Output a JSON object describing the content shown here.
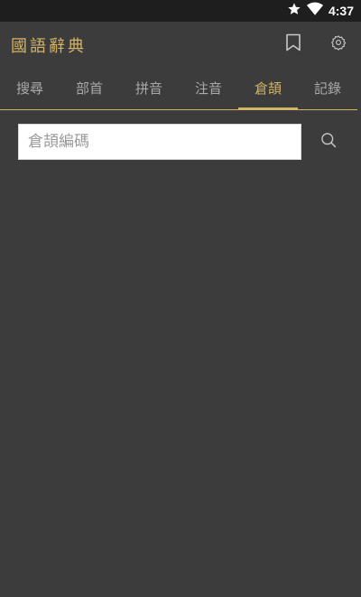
{
  "theme": {
    "accent": "#d4b465",
    "tab_text": "#a9a9a9",
    "icon_color": "#c8c8c8",
    "background": "#3c3c3c",
    "status_bar": "#1e1e1e"
  },
  "status_bar": {
    "time": "4:37",
    "icons": [
      "star-icon",
      "wifi-icon"
    ]
  },
  "app_bar": {
    "title": "國語辭典",
    "actions": [
      "bookmark-icon",
      "settings-icon"
    ]
  },
  "tabs": [
    {
      "label": "搜尋",
      "active": false
    },
    {
      "label": "部首",
      "active": false
    },
    {
      "label": "拼音",
      "active": false
    },
    {
      "label": "注音",
      "active": false
    },
    {
      "label": "倉頡",
      "active": true
    },
    {
      "label": "記錄",
      "active": false
    }
  ],
  "search": {
    "placeholder": "倉頡編碼",
    "value": "",
    "button_icon": "search-icon"
  }
}
